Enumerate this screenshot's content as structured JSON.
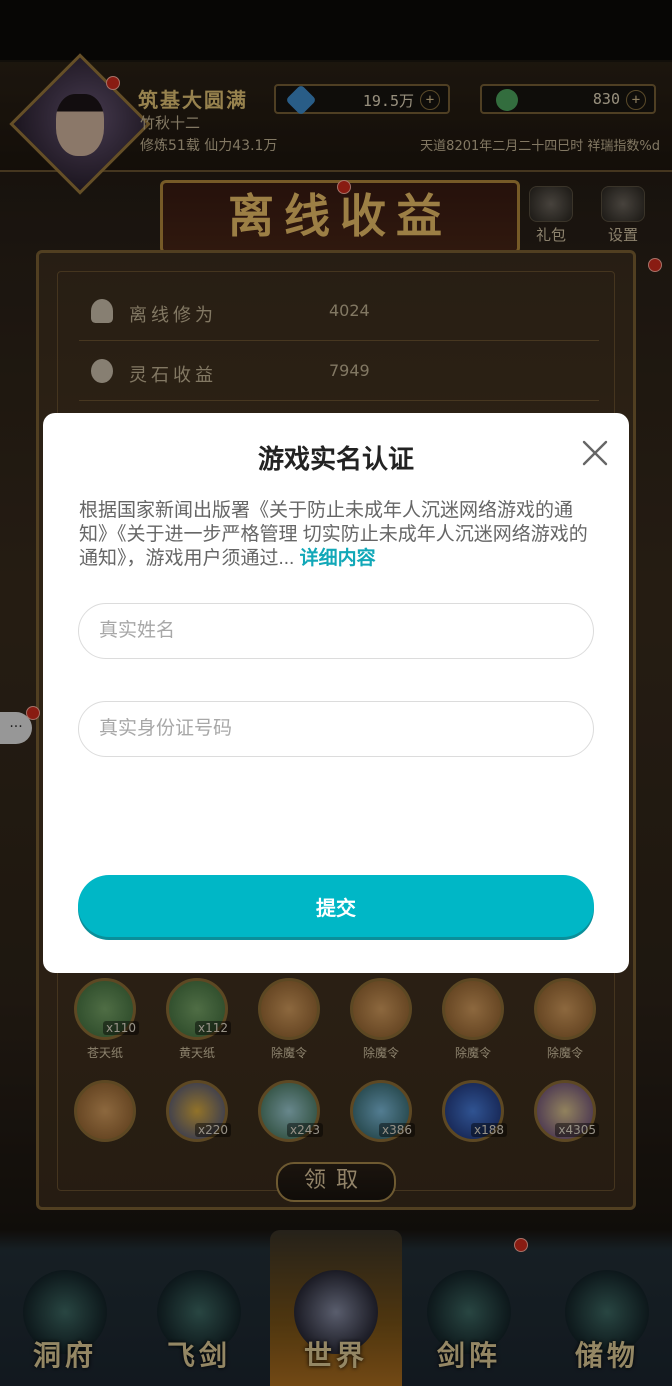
{
  "hud": {
    "title": "筑基大圆满",
    "player_name": "竹秋十二",
    "stats": "修炼51载 仙力43.1万",
    "date_info": "天道8201年二月二十四巳时 祥瑞指数%d",
    "currency_spirit": "19.5万",
    "currency_jade": "830"
  },
  "banner": {
    "title": "离线收益"
  },
  "side_buttons": {
    "gift": "礼包",
    "settings": "设置"
  },
  "offline_rows": [
    {
      "label": "离线修为",
      "value": "4024"
    },
    {
      "label": "灵石收益",
      "value": "7949"
    }
  ],
  "rewards_row1": [
    {
      "name": "苍天纸",
      "count": "x110"
    },
    {
      "name": "黄天纸",
      "count": "x112"
    },
    {
      "name": "除魔令",
      "count": ""
    },
    {
      "name": "除魔令",
      "count": ""
    },
    {
      "name": "除魔令",
      "count": ""
    },
    {
      "name": "除魔令",
      "count": ""
    }
  ],
  "rewards_row2": [
    {
      "count": ""
    },
    {
      "count": "x220"
    },
    {
      "count": "x243"
    },
    {
      "count": "x386"
    },
    {
      "count": "x188"
    },
    {
      "count": "x4305"
    }
  ],
  "claim_label": "领取",
  "chat_label": "···",
  "nav": [
    {
      "label": "洞府"
    },
    {
      "label": "飞剑"
    },
    {
      "label": "世界"
    },
    {
      "label": "剑阵"
    },
    {
      "label": "储物"
    }
  ],
  "dialog": {
    "title": "游戏实名认证",
    "description": "根据国家新闻出版署《关于防止未成年人沉迷网络游戏的通知》《关于进一步严格管理 切实防止未成年人沉迷网络游戏的通知》，游戏用户须通过...",
    "more_link": "详细内容",
    "name_placeholder": "真实姓名",
    "id_placeholder": "真实身份证号码",
    "submit_label": "提交"
  },
  "colors": {
    "accent": "#00b7c6",
    "link": "#12a8b8",
    "gold": "#e8c878",
    "panel_border": "#7d6234"
  }
}
